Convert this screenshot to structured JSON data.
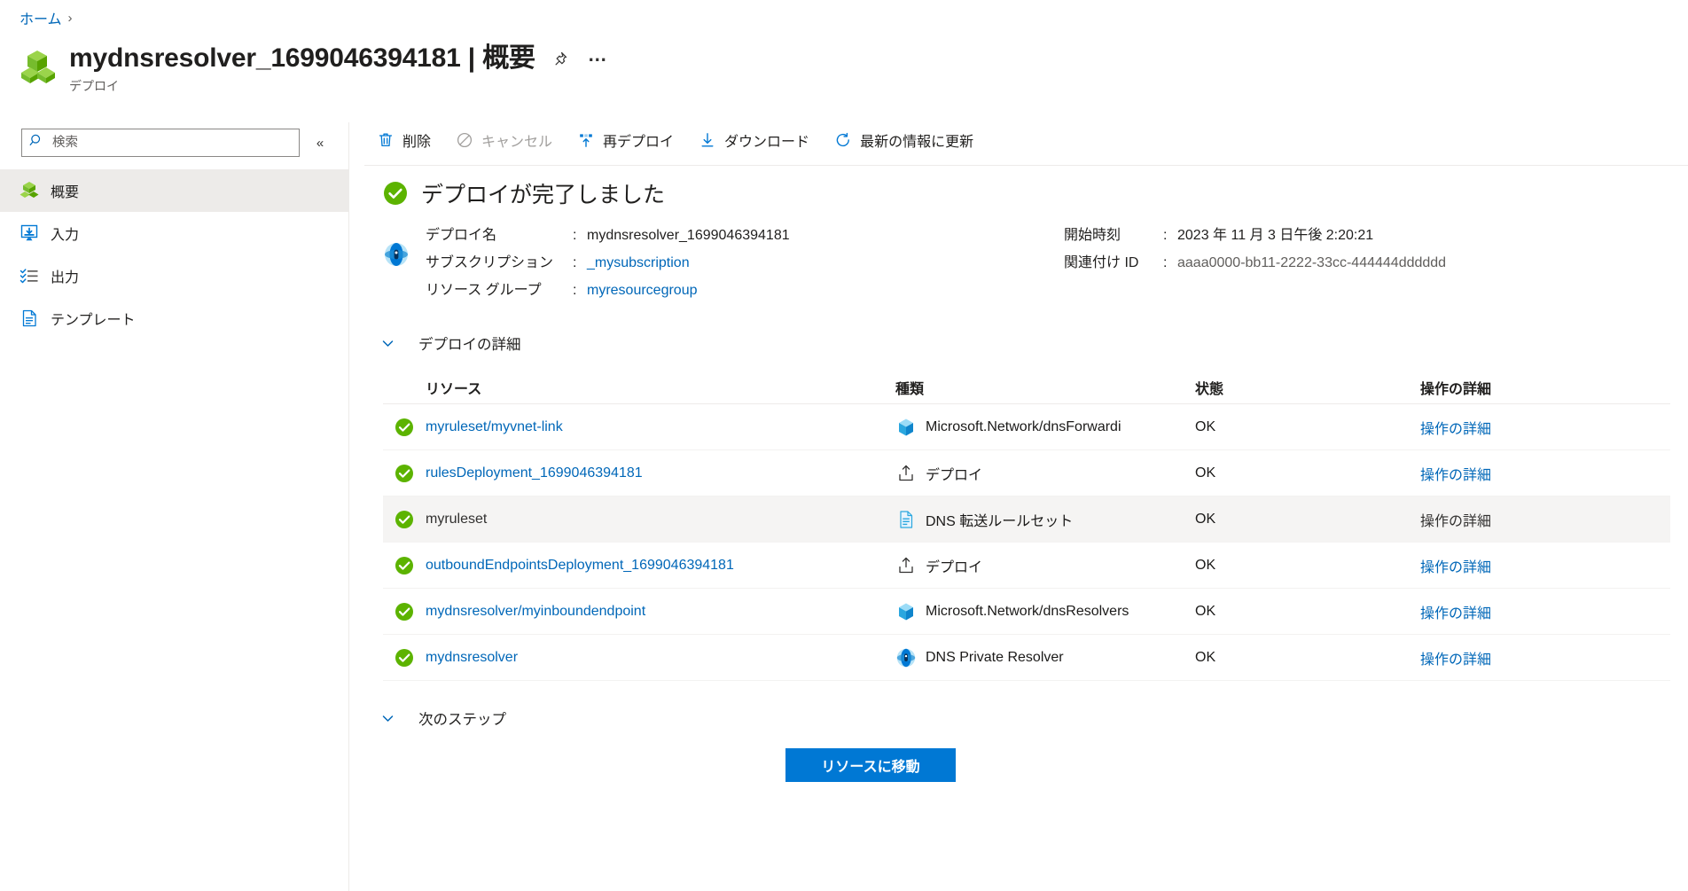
{
  "breadcrumb": {
    "items": [
      {
        "label": "ホーム",
        "separator": "›"
      }
    ]
  },
  "header": {
    "title": "mydnsresolver_1699046394181 | 概要",
    "subtitle": "デプロイ",
    "icon": "deployment-cubes-icon",
    "pin_label": "ピン留め",
    "more_label": "…"
  },
  "sidebar": {
    "search": {
      "placeholder": "検索",
      "value": "",
      "icon": "search-icon"
    },
    "collapse": {
      "label": "«",
      "name": "collapse-sidebar-button"
    },
    "items": [
      {
        "label": "概要",
        "icon": "overview-cubes-icon",
        "selected": true
      },
      {
        "label": "入力",
        "icon": "inputs-icon",
        "selected": false
      },
      {
        "label": "出力",
        "icon": "outputs-icon",
        "selected": false
      },
      {
        "label": "テンプレート",
        "icon": "template-file-icon",
        "selected": false
      }
    ]
  },
  "toolbar": {
    "buttons": [
      {
        "label": "削除",
        "icon": "trash-icon",
        "disabled": false
      },
      {
        "label": "キャンセル",
        "icon": "cancel-icon",
        "disabled": true
      },
      {
        "label": "再デプロイ",
        "icon": "redeploy-icon",
        "disabled": false
      },
      {
        "label": "ダウンロード",
        "icon": "download-icon",
        "disabled": false
      },
      {
        "label": "最新の情報に更新",
        "icon": "refresh-icon",
        "disabled": false
      }
    ]
  },
  "status": {
    "icon": "success-check-icon",
    "title": "デプロイが完了しました",
    "resource_icon": "dns-resolver-icon",
    "left_fields": [
      {
        "key": "デプロイ名",
        "colon": ":",
        "value": "mydnsresolver_1699046394181",
        "kind": "text"
      },
      {
        "key": "サブスクリプション",
        "colon": ":",
        "value": "_mysubscription",
        "kind": "link"
      },
      {
        "key": "リソース グループ",
        "colon": ":",
        "value": "myresourcegroup",
        "kind": "link"
      }
    ],
    "right_fields": [
      {
        "key": "開始時刻",
        "colon": ":",
        "value": "2023 年 11 月 3 日午後 2:20:21",
        "kind": "text"
      },
      {
        "key": "関連付け ID",
        "colon": ":",
        "value": "aaaa0000-bb11-2222-33cc-444444dddddd",
        "kind": "muted"
      }
    ]
  },
  "details_section": {
    "title": "デプロイの詳細",
    "expanded": true,
    "chevron": "chevron-down-icon",
    "columns": {
      "state": "",
      "resource": "リソース",
      "type": "種類",
      "status": "状態",
      "operation": "操作の詳細"
    },
    "rows": [
      {
        "state_icon": "success-check-icon",
        "resource": "myruleset/myvnet-link",
        "resource_kind": "link",
        "type_icon": "dns-forwarding-ruleset-icon",
        "type": "Microsoft.Network/dnsForwardi",
        "status": "OK",
        "operation": "操作の詳細",
        "operation_kind": "link",
        "highlighted": false
      },
      {
        "state_icon": "success-check-icon",
        "resource": "rulesDeployment_1699046394181",
        "resource_kind": "link",
        "type_icon": "deployment-upload-icon",
        "type": "デプロイ",
        "status": "OK",
        "operation": "操作の詳細",
        "operation_kind": "link",
        "highlighted": false
      },
      {
        "state_icon": "success-check-icon",
        "resource": "myruleset",
        "resource_kind": "visited",
        "type_icon": "dns-ruleset-doc-icon",
        "type": "DNS 転送ルールセット",
        "status": "OK",
        "operation": "操作の詳細",
        "operation_kind": "visited",
        "highlighted": true
      },
      {
        "state_icon": "success-check-icon",
        "resource": "outboundEndpointsDeployment_1699046394181",
        "resource_kind": "link",
        "type_icon": "deployment-upload-icon",
        "type": "デプロイ",
        "status": "OK",
        "operation": "操作の詳細",
        "operation_kind": "link",
        "highlighted": false
      },
      {
        "state_icon": "success-check-icon",
        "resource": "mydnsresolver/myinboundendpoint",
        "resource_kind": "link",
        "type_icon": "dns-forwarding-ruleset-icon",
        "type": "Microsoft.Network/dnsResolvers",
        "status": "OK",
        "operation": "操作の詳細",
        "operation_kind": "link",
        "highlighted": false
      },
      {
        "state_icon": "success-check-icon",
        "resource": "mydnsresolver",
        "resource_kind": "link",
        "type_icon": "dns-resolver-icon",
        "type": "DNS Private Resolver",
        "status": "OK",
        "operation": "操作の詳細",
        "operation_kind": "link",
        "highlighted": false
      }
    ]
  },
  "next_steps": {
    "title": "次のステップ",
    "expanded": true,
    "chevron": "chevron-down-icon",
    "primary_button": "リソースに移動"
  },
  "colors": {
    "accent": "#0078d4",
    "link": "#0067b8",
    "success": "#5cb300",
    "selected_row": "#f5f4f3",
    "selected_nav": "#edebe9",
    "divider": "#edebe9"
  }
}
